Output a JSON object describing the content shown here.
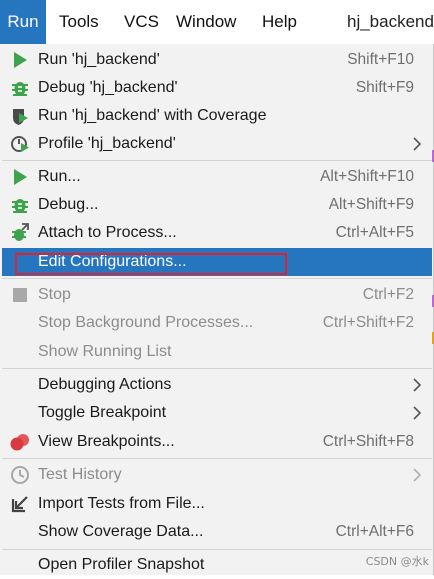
{
  "menubar": {
    "items": [
      {
        "label": "Run"
      },
      {
        "label": "Tools"
      },
      {
        "label": "VCS"
      },
      {
        "label": "Window"
      },
      {
        "label": "Help"
      }
    ],
    "title": "hj_backend"
  },
  "menu": {
    "run_project": {
      "label": "Run 'hj_backend'",
      "shortcut": "Shift+F10",
      "icon": "run-icon"
    },
    "debug_project": {
      "label": "Debug 'hj_backend'",
      "shortcut": "Shift+F9",
      "icon": "debug-icon"
    },
    "coverage_project": {
      "label": "Run 'hj_backend' with Coverage",
      "icon": "coverage-icon"
    },
    "profile_project": {
      "label": "Profile 'hj_backend'",
      "icon": "profile-icon"
    },
    "run": {
      "label": "Run...",
      "shortcut": "Alt+Shift+F10",
      "icon": "run-icon"
    },
    "debug": {
      "label": "Debug...",
      "shortcut": "Alt+Shift+F9",
      "icon": "debug-icon"
    },
    "attach": {
      "label": "Attach to Process...",
      "shortcut": "Ctrl+Alt+F5",
      "icon": "attach-icon"
    },
    "edit_config": {
      "label": "Edit Configurations..."
    },
    "stop": {
      "label": "Stop",
      "shortcut": "Ctrl+F2",
      "icon": "stop-icon"
    },
    "stop_background": {
      "label": "Stop Background Processes...",
      "shortcut": "Ctrl+Shift+F2"
    },
    "show_running": {
      "label": "Show Running List"
    },
    "debugging_actions": {
      "label": "Debugging Actions"
    },
    "toggle_breakpoint": {
      "label": "Toggle Breakpoint"
    },
    "view_breakpoints": {
      "label": "View Breakpoints...",
      "shortcut": "Ctrl+Shift+F8",
      "icon": "breakpoints-icon"
    },
    "test_history": {
      "label": "Test History",
      "icon": "clock-icon"
    },
    "import_tests": {
      "label": "Import Tests from File...",
      "icon": "import-icon"
    },
    "show_coverage": {
      "label": "Show Coverage Data...",
      "shortcut": "Ctrl+Alt+F6"
    },
    "open_profiler": {
      "label": "Open Profiler Snapshot"
    }
  },
  "watermark": "CSDN @水k",
  "colors": {
    "accent": "#2675bf",
    "run_green": "#3fa34d",
    "highlight_red": "#e0212f"
  }
}
